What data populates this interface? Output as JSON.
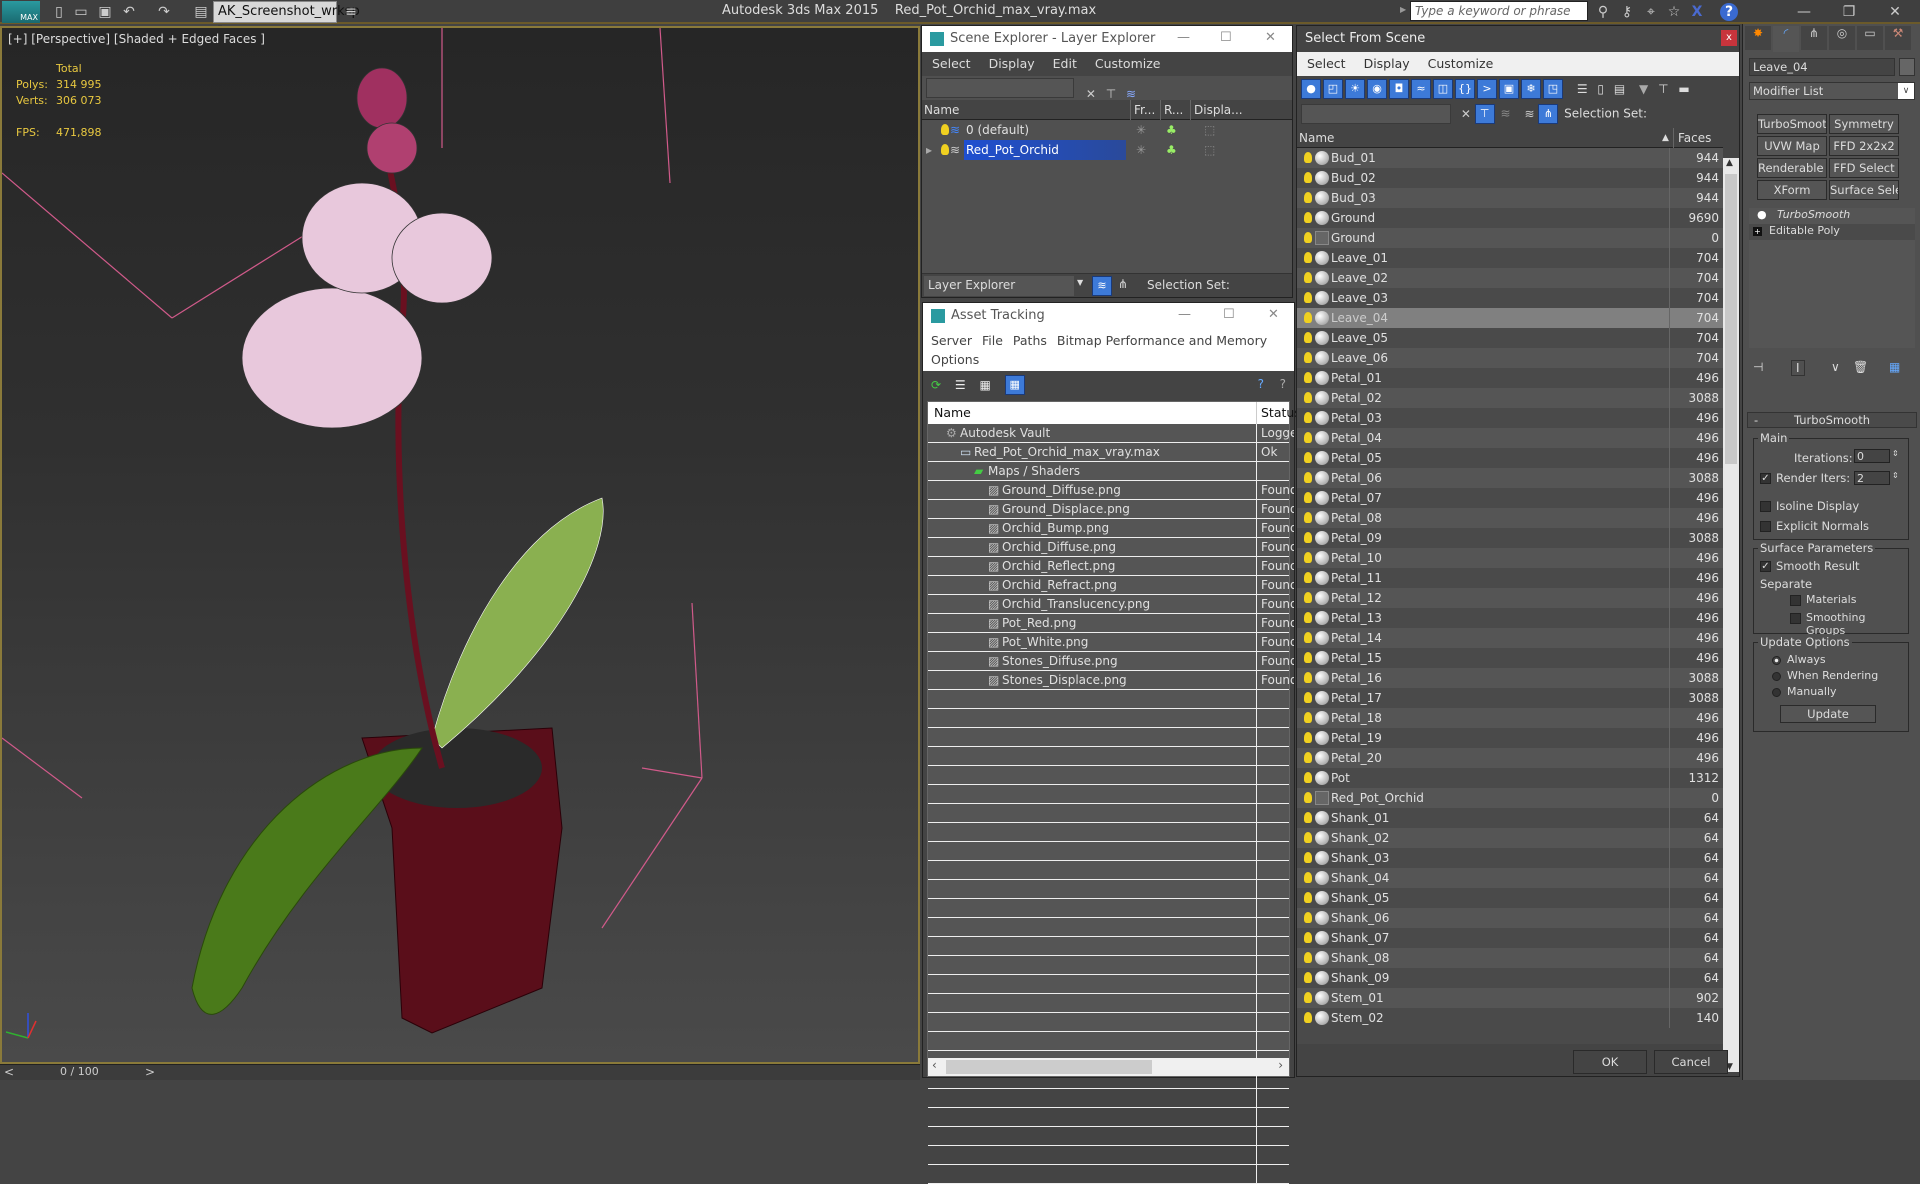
{
  "topbar": {
    "app_logo": "MAX",
    "workspace": "AK_Screenshot_wrksp",
    "title": "Autodesk 3ds Max  2015",
    "filename": "Red_Pot_Orchid_max_vray.max",
    "search_placeholder": "Type a keyword or phrase",
    "icons": [
      "new-file-icon",
      "open-file-icon",
      "save-icon",
      "undo-icon",
      "redo-icon",
      "project-folder-icon"
    ],
    "help_icons": [
      "binoculars-icon",
      "key-icon",
      "satellite-icon",
      "star-icon",
      "x-icon",
      "help-icon"
    ]
  },
  "viewport": {
    "label": "[+] [Perspective] [Shaded + Edged Faces ]",
    "stats": {
      "total_label": "Total",
      "polys_label": "Polys:",
      "polys": "314 995",
      "verts_label": "Verts:",
      "verts": "306 073",
      "fps_label": "FPS:",
      "fps": "471,898"
    },
    "timeline": {
      "prev": "<",
      "frame": "0 / 100",
      "next": ">"
    }
  },
  "scene_explorer": {
    "title": "Scene Explorer - Layer Explorer",
    "menu": [
      "Select",
      "Display",
      "Edit",
      "Customize"
    ],
    "columns": [
      "Name",
      "Fr...",
      "R...",
      "Displa..."
    ],
    "rows": [
      {
        "name": "0 (default)",
        "selected": false
      },
      {
        "name": "Red_Pot_Orchid",
        "selected": true
      }
    ],
    "footer_mode": "Layer Explorer",
    "selection_set_label": "Selection Set:"
  },
  "asset_tracking": {
    "title": "Asset Tracking",
    "menu": [
      "Server",
      "File",
      "Paths",
      "Bitmap Performance and Memory",
      "Options"
    ],
    "columns": [
      "Name",
      "Status"
    ],
    "rows": [
      {
        "name": "Autodesk Vault",
        "status": "Logged",
        "level": 1,
        "icon": "vault-icon"
      },
      {
        "name": "Red_Pot_Orchid_max_vray.max",
        "status": "Ok",
        "level": 2,
        "icon": "max-file-icon"
      },
      {
        "name": "Maps / Shaders",
        "status": "",
        "level": 3,
        "icon": "maps-icon"
      },
      {
        "name": "Ground_Diffuse.png",
        "status": "Found",
        "level": 4,
        "icon": "image-file-icon"
      },
      {
        "name": "Ground_Displace.png",
        "status": "Found",
        "level": 4,
        "icon": "image-file-icon"
      },
      {
        "name": "Orchid_Bump.png",
        "status": "Found",
        "level": 4,
        "icon": "image-file-icon"
      },
      {
        "name": "Orchid_Diffuse.png",
        "status": "Found",
        "level": 4,
        "icon": "image-file-icon"
      },
      {
        "name": "Orchid_Reflect.png",
        "status": "Found",
        "level": 4,
        "icon": "image-file-icon"
      },
      {
        "name": "Orchid_Refract.png",
        "status": "Found",
        "level": 4,
        "icon": "image-file-icon"
      },
      {
        "name": "Orchid_Translucency.png",
        "status": "Found",
        "level": 4,
        "icon": "image-file-icon"
      },
      {
        "name": "Pot_Red.png",
        "status": "Found",
        "level": 4,
        "icon": "image-file-icon"
      },
      {
        "name": "Pot_White.png",
        "status": "Found",
        "level": 4,
        "icon": "image-file-icon"
      },
      {
        "name": "Stones_Diffuse.png",
        "status": "Found",
        "level": 4,
        "icon": "image-file-icon"
      },
      {
        "name": "Stones_Displace.png",
        "status": "Found",
        "level": 4,
        "icon": "image-file-icon"
      }
    ]
  },
  "select_from_scene": {
    "title": "Select From Scene",
    "menu": [
      "Select",
      "Display",
      "Customize"
    ],
    "selection_set_label": "Selection Set:",
    "columns": [
      "Name",
      "Faces"
    ],
    "rows": [
      {
        "name": "Bud_01",
        "faces": "944",
        "type": "geometry"
      },
      {
        "name": "Bud_02",
        "faces": "944",
        "type": "geometry"
      },
      {
        "name": "Bud_03",
        "faces": "944",
        "type": "geometry"
      },
      {
        "name": "Ground",
        "faces": "9690",
        "type": "geometry"
      },
      {
        "name": "Ground",
        "faces": "0",
        "type": "group"
      },
      {
        "name": "Leave_01",
        "faces": "704",
        "type": "geometry"
      },
      {
        "name": "Leave_02",
        "faces": "704",
        "type": "geometry"
      },
      {
        "name": "Leave_03",
        "faces": "704",
        "type": "geometry"
      },
      {
        "name": "Leave_04",
        "faces": "704",
        "type": "geometry",
        "selected": true
      },
      {
        "name": "Leave_05",
        "faces": "704",
        "type": "geometry"
      },
      {
        "name": "Leave_06",
        "faces": "704",
        "type": "geometry"
      },
      {
        "name": "Petal_01",
        "faces": "496",
        "type": "geometry"
      },
      {
        "name": "Petal_02",
        "faces": "3088",
        "type": "geometry"
      },
      {
        "name": "Petal_03",
        "faces": "496",
        "type": "geometry"
      },
      {
        "name": "Petal_04",
        "faces": "496",
        "type": "geometry"
      },
      {
        "name": "Petal_05",
        "faces": "496",
        "type": "geometry"
      },
      {
        "name": "Petal_06",
        "faces": "3088",
        "type": "geometry"
      },
      {
        "name": "Petal_07",
        "faces": "496",
        "type": "geometry"
      },
      {
        "name": "Petal_08",
        "faces": "496",
        "type": "geometry"
      },
      {
        "name": "Petal_09",
        "faces": "3088",
        "type": "geometry"
      },
      {
        "name": "Petal_10",
        "faces": "496",
        "type": "geometry"
      },
      {
        "name": "Petal_11",
        "faces": "496",
        "type": "geometry"
      },
      {
        "name": "Petal_12",
        "faces": "496",
        "type": "geometry"
      },
      {
        "name": "Petal_13",
        "faces": "496",
        "type": "geometry"
      },
      {
        "name": "Petal_14",
        "faces": "496",
        "type": "geometry"
      },
      {
        "name": "Petal_15",
        "faces": "496",
        "type": "geometry"
      },
      {
        "name": "Petal_16",
        "faces": "3088",
        "type": "geometry"
      },
      {
        "name": "Petal_17",
        "faces": "3088",
        "type": "geometry"
      },
      {
        "name": "Petal_18",
        "faces": "496",
        "type": "geometry"
      },
      {
        "name": "Petal_19",
        "faces": "496",
        "type": "geometry"
      },
      {
        "name": "Petal_20",
        "faces": "496",
        "type": "geometry"
      },
      {
        "name": "Pot",
        "faces": "1312",
        "type": "geometry"
      },
      {
        "name": "Red_Pot_Orchid",
        "faces": "0",
        "type": "group"
      },
      {
        "name": "Shank_01",
        "faces": "64",
        "type": "geometry"
      },
      {
        "name": "Shank_02",
        "faces": "64",
        "type": "geometry"
      },
      {
        "name": "Shank_03",
        "faces": "64",
        "type": "geometry"
      },
      {
        "name": "Shank_04",
        "faces": "64",
        "type": "geometry"
      },
      {
        "name": "Shank_05",
        "faces": "64",
        "type": "geometry"
      },
      {
        "name": "Shank_06",
        "faces": "64",
        "type": "geometry"
      },
      {
        "name": "Shank_07",
        "faces": "64",
        "type": "geometry"
      },
      {
        "name": "Shank_08",
        "faces": "64",
        "type": "geometry"
      },
      {
        "name": "Shank_09",
        "faces": "64",
        "type": "geometry"
      },
      {
        "name": "Stem_01",
        "faces": "902",
        "type": "geometry"
      },
      {
        "name": "Stem_02",
        "faces": "140",
        "type": "geometry"
      }
    ],
    "ok_label": "OK",
    "cancel_label": "Cancel"
  },
  "command_panel": {
    "tabs": [
      "create-tab",
      "modify-tab",
      "hierarchy-tab",
      "motion-tab",
      "display-tab",
      "utilities-tab"
    ],
    "object_name": "Leave_04",
    "modifier_list_label": "Modifier List",
    "modifier_buttons": [
      "TurboSmooth",
      "Symmetry",
      "UVW Map",
      "FFD 2x2x2",
      "Renderable Spline",
      "FFD Select",
      "XForm",
      "Surface Select"
    ],
    "stack": [
      {
        "name": "TurboSmooth",
        "active": true
      },
      {
        "name": "Editable Poly",
        "active": false
      }
    ],
    "rollout": {
      "title": "TurboSmooth",
      "collapse": "-",
      "main_group": "Main",
      "iterations_label": "Iterations:",
      "iterations": "0",
      "render_iters_label": "Render Iters:",
      "render_iters": "2",
      "render_iters_checked": true,
      "isoline_label": "Isoline Display",
      "isoline_checked": false,
      "explicit_normals_label": "Explicit Normals",
      "explicit_normals_checked": false,
      "surface_group": "Surface Parameters",
      "smooth_result_label": "Smooth Result",
      "smooth_result_checked": true,
      "separate_label": "Separate",
      "materials_label": "Materials",
      "materials_checked": false,
      "smoothing_groups_label": "Smoothing Groups",
      "smoothing_groups_checked": false,
      "update_group": "Update Options",
      "update_options": [
        "Always",
        "When Rendering",
        "Manually"
      ],
      "update_selected": "Always",
      "update_button": "Update"
    }
  },
  "colors": {
    "accent": "#3d7ad8",
    "selection": "#1f4fd0",
    "stats": "#e8c840",
    "viewport_border": "#8a7a3a",
    "close_red": "#c8343c"
  }
}
